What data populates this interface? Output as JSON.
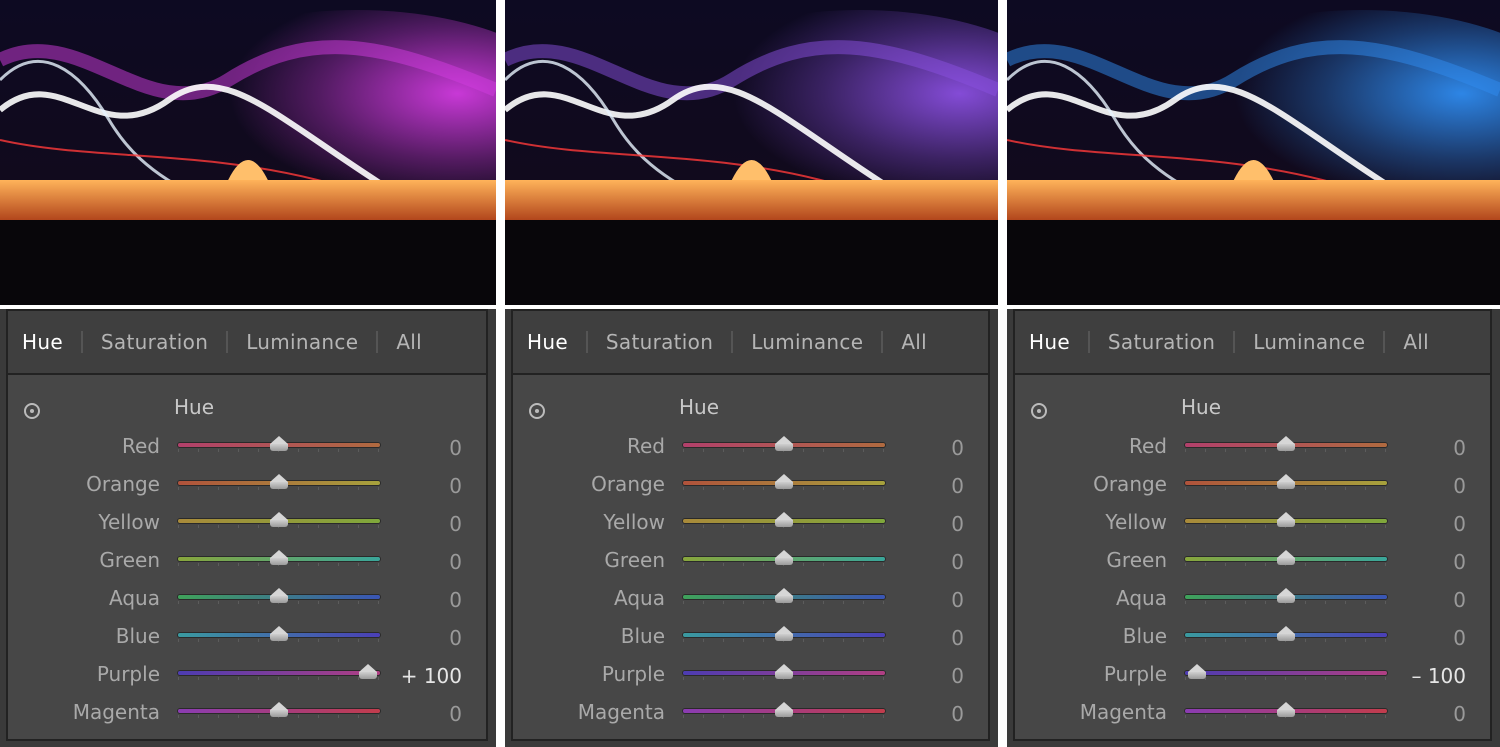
{
  "panels": [
    {
      "tabs": [
        "Hue",
        "Saturation",
        "Luminance",
        "All"
      ],
      "active_tab": "Hue",
      "section_title": "Hue",
      "glow_color": "#d23be0",
      "rows": [
        {
          "label": "Red",
          "value": "0",
          "level": 0
        },
        {
          "label": "Orange",
          "value": "0",
          "level": 0
        },
        {
          "label": "Yellow",
          "value": "0",
          "level": 0
        },
        {
          "label": "Green",
          "value": "0",
          "level": 0
        },
        {
          "label": "Aqua",
          "value": "0",
          "level": 0
        },
        {
          "label": "Blue",
          "value": "0",
          "level": 0
        },
        {
          "label": "Purple",
          "value": "+ 100",
          "level": 100
        },
        {
          "label": "Magenta",
          "value": "0",
          "level": 0
        }
      ]
    },
    {
      "tabs": [
        "Hue",
        "Saturation",
        "Luminance",
        "All"
      ],
      "active_tab": "Hue",
      "section_title": "Hue",
      "glow_color": "#8a4fe0",
      "rows": [
        {
          "label": "Red",
          "value": "0",
          "level": 0
        },
        {
          "label": "Orange",
          "value": "0",
          "level": 0
        },
        {
          "label": "Yellow",
          "value": "0",
          "level": 0
        },
        {
          "label": "Green",
          "value": "0",
          "level": 0
        },
        {
          "label": "Aqua",
          "value": "0",
          "level": 0
        },
        {
          "label": "Blue",
          "value": "0",
          "level": 0
        },
        {
          "label": "Purple",
          "value": "0",
          "level": 0
        },
        {
          "label": "Magenta",
          "value": "0",
          "level": 0
        }
      ]
    },
    {
      "tabs": [
        "Hue",
        "Saturation",
        "Luminance",
        "All"
      ],
      "active_tab": "Hue",
      "section_title": "Hue",
      "glow_color": "#2f8cf0",
      "rows": [
        {
          "label": "Red",
          "value": "0",
          "level": 0
        },
        {
          "label": "Orange",
          "value": "0",
          "level": 0
        },
        {
          "label": "Yellow",
          "value": "0",
          "level": 0
        },
        {
          "label": "Green",
          "value": "0",
          "level": 0
        },
        {
          "label": "Aqua",
          "value": "0",
          "level": 0
        },
        {
          "label": "Blue",
          "value": "0",
          "level": 0
        },
        {
          "label": "Purple",
          "value": "– 100",
          "level": -100
        },
        {
          "label": "Magenta",
          "value": "0",
          "level": 0
        }
      ]
    }
  ],
  "track_gradients": {
    "Red": [
      "#b2406b",
      "#b06a3f"
    ],
    "Orange": [
      "#b0523b",
      "#a7a23c"
    ],
    "Yellow": [
      "#a98a3a",
      "#7fa83b"
    ],
    "Green": [
      "#88a63c",
      "#3aa69a"
    ],
    "Aqua": [
      "#3fa25a",
      "#3a55b5"
    ],
    "Blue": [
      "#3a9aa0",
      "#4a3fb6"
    ],
    "Purple": [
      "#4c3cb2",
      "#b13f83"
    ],
    "Magenta": [
      "#8a3cb2",
      "#c23c4c"
    ]
  }
}
